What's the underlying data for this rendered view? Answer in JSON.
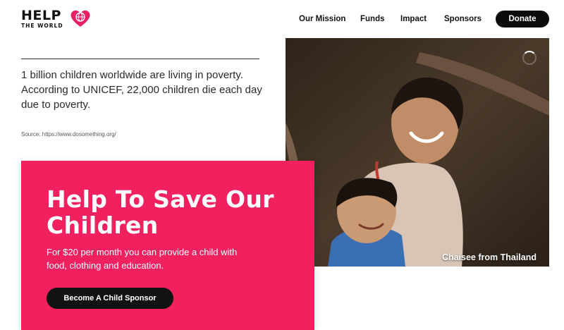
{
  "logo": {
    "primary": "HELP",
    "secondary": "THE WORLD",
    "heart_color": "#e91e63"
  },
  "nav": {
    "items": [
      "Our Mission",
      "Funds",
      "Impact",
      "Sponsors"
    ],
    "donate_label": "Donate"
  },
  "stats": {
    "line1": "1 billion children worldwide are living in poverty.",
    "line2": "According to UNICEF, 22,000 children die each day due to poverty.",
    "source": "Source: https://www.dosomething.org/"
  },
  "photo": {
    "caption": "Chaisee from Thailand"
  },
  "card": {
    "title": "Help To Save Our Children",
    "text": "For $20 per month you can provide a child with food, clothing and education.",
    "button_label": "Become A Child Sponsor",
    "background": "#f1205f"
  }
}
